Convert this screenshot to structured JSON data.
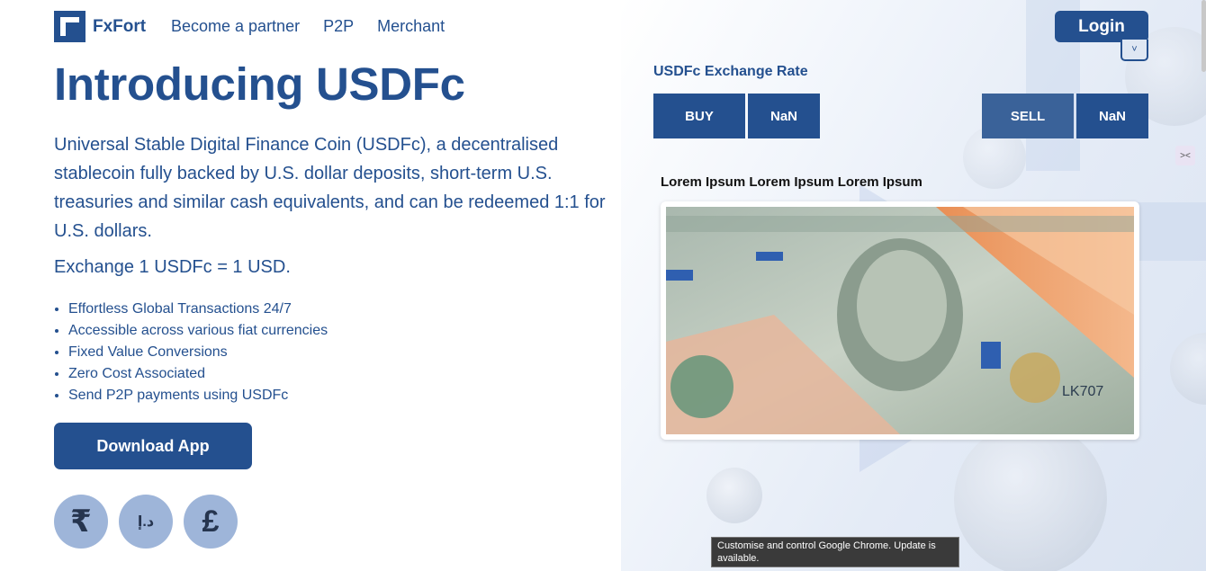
{
  "brand": {
    "name": "FxFort"
  },
  "nav": {
    "items": [
      "Become a partner",
      "P2P",
      "Merchant"
    ]
  },
  "header": {
    "login_label": "Login",
    "toggle_icon": "˅"
  },
  "hero": {
    "title": "Introducing USDFc",
    "description": "Universal Stable Digital Finance Coin (USDFc), a decentralised stablecoin fully backed by U.S. dollar deposits, short-term U.S. treasuries and similar cash equivalents, and can be redeemed 1:1 for U.S. dollars.",
    "exchange": "Exchange 1 USDFc = 1 USD.",
    "features": [
      "Effortless Global Transactions 24/7",
      "Accessible across various fiat currencies",
      "Fixed Value Conversions",
      "Zero Cost Associated",
      "Send P2P payments using USDFc"
    ],
    "download_label": "Download App",
    "currencies": [
      "₹",
      "د.إ",
      "£"
    ]
  },
  "rate": {
    "title": "USDFc Exchange Rate",
    "buy_label": "BUY",
    "buy_value": "NaN",
    "sell_label": "SELL",
    "sell_value": "NaN"
  },
  "promo": {
    "caption": "Lorem Ipsum Lorem Ipsum Lorem Ipsum"
  },
  "tooltip": {
    "text": "Customise and control Google Chrome. Update is available."
  },
  "colors": {
    "primary": "#24508f",
    "currency_circle": "#9eb5d9"
  }
}
